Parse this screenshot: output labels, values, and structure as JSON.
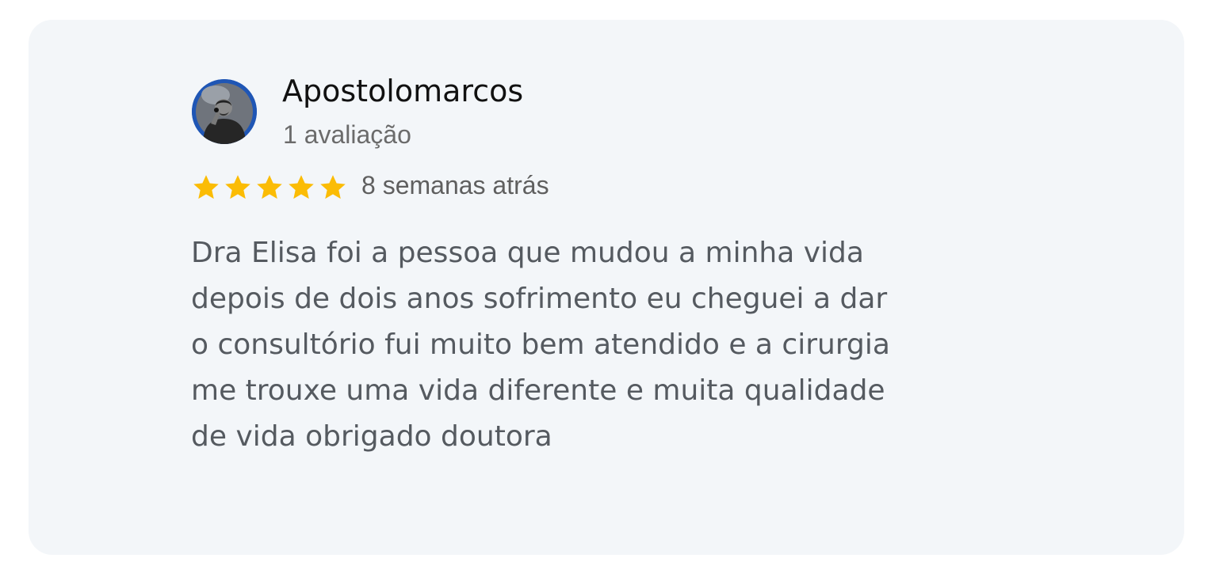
{
  "review": {
    "author_name": "Apostolomarcos",
    "review_count": "1 avaliação",
    "rating": 5,
    "rating_max": 5,
    "date": "8 semanas atrás",
    "text": "Dra Elisa foi a pessoa que mudou a minha vida\ndepois de dois anos sofrimento eu cheguei a dar\no consultório fui muito bem atendido e a cirurgia\nme trouxe uma vida diferente e muita qualidade\nde vida obrigado doutora"
  },
  "colors": {
    "card_background": "#f3f6f9",
    "star": "#fbbc05",
    "avatar_ring": "#1f56b5"
  },
  "icons": {
    "avatar": "user-photo-avatar",
    "star": "star-icon"
  }
}
